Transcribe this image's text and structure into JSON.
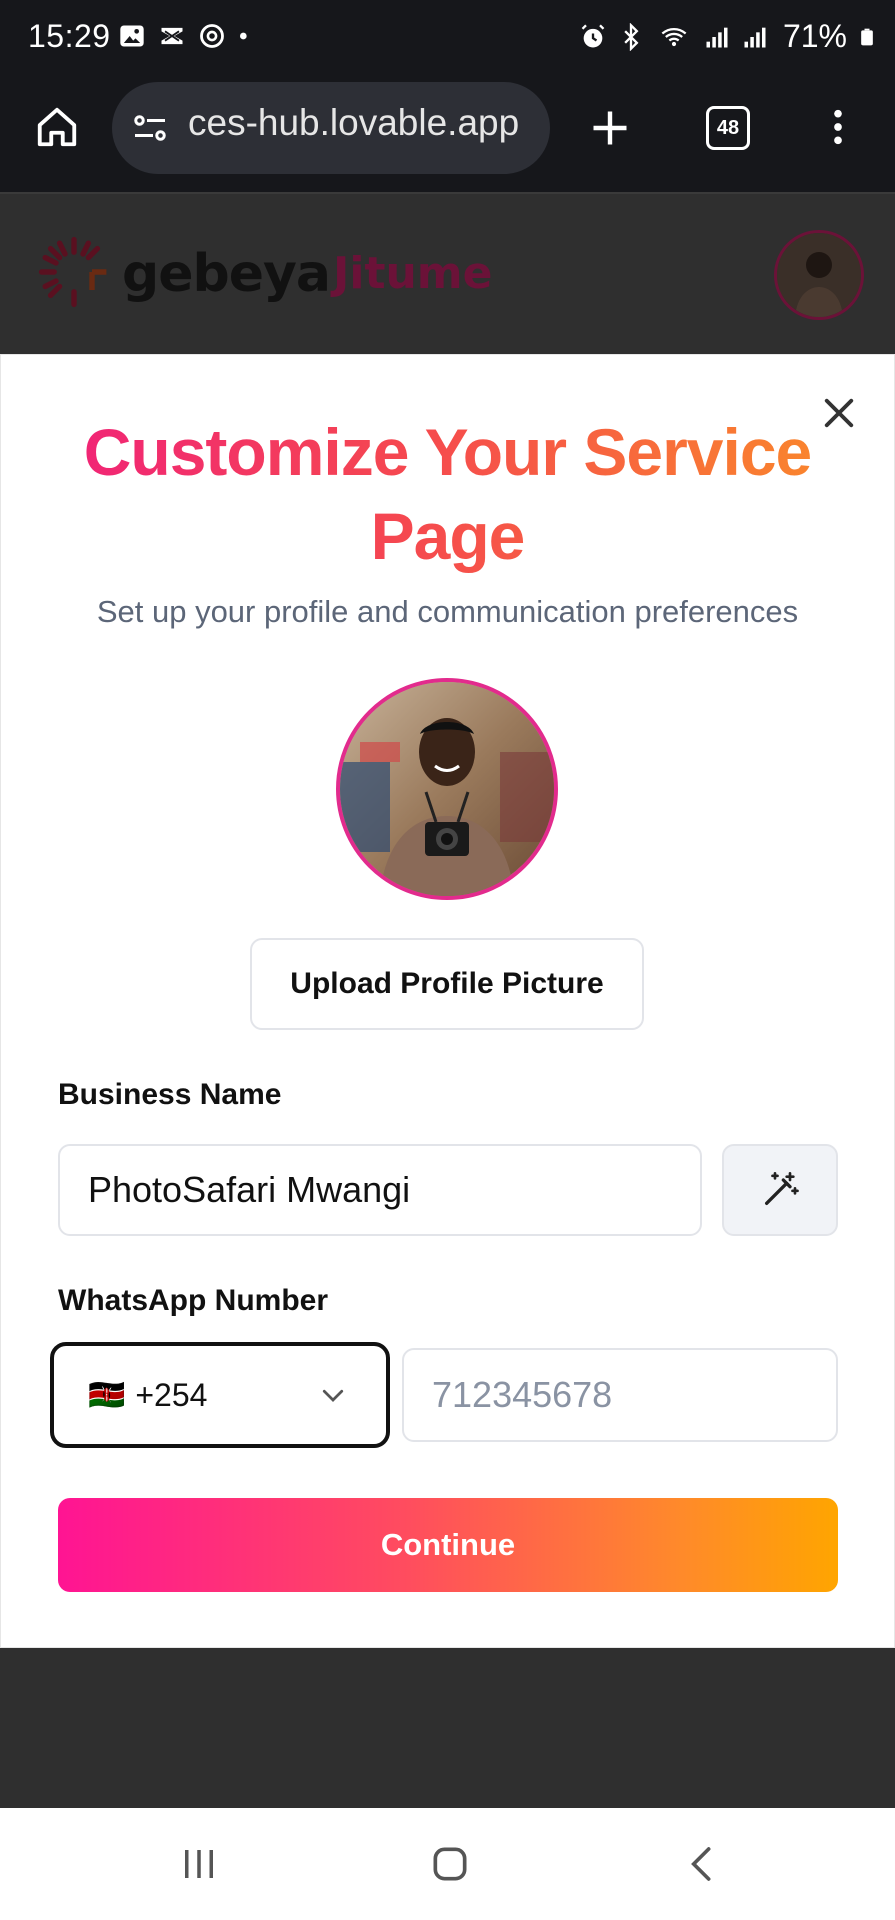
{
  "status_bar": {
    "time": "15:29",
    "battery": "71%",
    "icons_left": [
      "gallery-icon",
      "capcut-icon",
      "threads-icon",
      "dot-icon"
    ],
    "icons_right": [
      "alarm-icon",
      "bluetooth-icon",
      "wifi-icon",
      "signal-icon",
      "signal-icon",
      "battery-icon"
    ]
  },
  "browser": {
    "url": "ces-hub.lovable.app",
    "tab_count": "48"
  },
  "app_header": {
    "brand": "gebeya",
    "product": "Jitume"
  },
  "modal": {
    "title": "Customize Your Service Page",
    "subtitle": "Set up your profile and communication preferences",
    "upload_button": "Upload Profile Picture",
    "business_name_label": "Business Name",
    "business_name_value": "PhotoSafari Mwangi",
    "whatsapp_label": "WhatsApp Number",
    "country_flag": "🇰🇪",
    "country_code": "+254",
    "phone_placeholder": "712345678",
    "continue_button": "Continue"
  },
  "colors": {
    "brand_pink": "#f0217a",
    "brand_orange": "#ffa500",
    "brand_maroon": "#6b1238"
  }
}
